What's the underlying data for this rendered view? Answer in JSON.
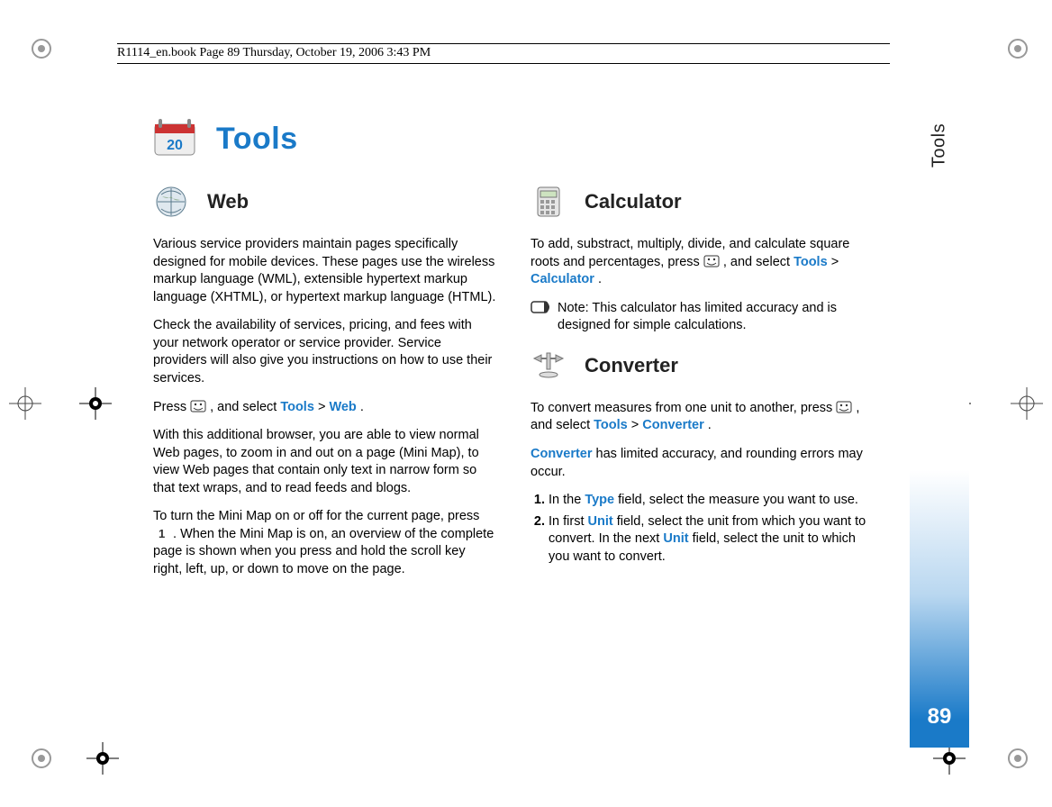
{
  "doc_path": "R1114_en.book  Page 89  Thursday, October 19, 2006  3:43 PM",
  "side": {
    "label": "Tools",
    "page_number": "89"
  },
  "title": "Tools",
  "web": {
    "heading": "Web",
    "p1": "Various service providers maintain pages specifically designed for mobile devices. These pages use the wireless markup language (WML), extensible hypertext markup language (XHTML), or hypertext markup language (HTML).",
    "p2": "Check the availability of services, pricing, and fees with your network operator or service provider. Service providers will also give you instructions on how to use their services.",
    "p3_pre": "Press ",
    "p3_mid": " , and select ",
    "p3_tools": "Tools",
    "p3_gt": " > ",
    "p3_web": "Web",
    "p3_post": ".",
    "p4": "With this additional browser, you are able to view normal Web pages, to zoom in and out on a page (Mini Map), to view Web pages that contain only text in narrow form so that text wraps, and to read feeds and blogs.",
    "p5_pre": "To turn the Mini Map on or off for the current page, press ",
    "p5_post": " . When the Mini Map is on, an overview of the complete page is shown when you press and hold the scroll key right, left, up, or down to move on the page."
  },
  "calculator": {
    "heading": "Calculator",
    "p1_pre": "To add, substract, multiply, divide, and calculate square roots and percentages, press ",
    "p1_mid": " , and select ",
    "p1_tools": "Tools",
    "p1_gt": " > ",
    "p1_calc": "Calculator",
    "p1_post": ".",
    "note": "Note: This calculator has limited accuracy and is designed for simple calculations."
  },
  "converter": {
    "heading": "Converter",
    "p1_pre": "To convert measures from one unit to another, press ",
    "p1_mid": " , and select ",
    "p1_tools": "Tools",
    "p1_gt": " > ",
    "p1_conv": "Converter",
    "p1_post": ".",
    "p2_link": "Converter",
    "p2_rest": " has limited accuracy, and rounding errors may occur.",
    "step1_pre": "In the ",
    "step1_type": "Type",
    "step1_post": " field, select the measure you want to use.",
    "step2_pre": "In first ",
    "step2_unit": "Unit",
    "step2_mid": " field, select the unit from which you want to convert. In the next ",
    "step2_unit2": "Unit",
    "step2_post": " field, select the unit to which you want to convert."
  }
}
